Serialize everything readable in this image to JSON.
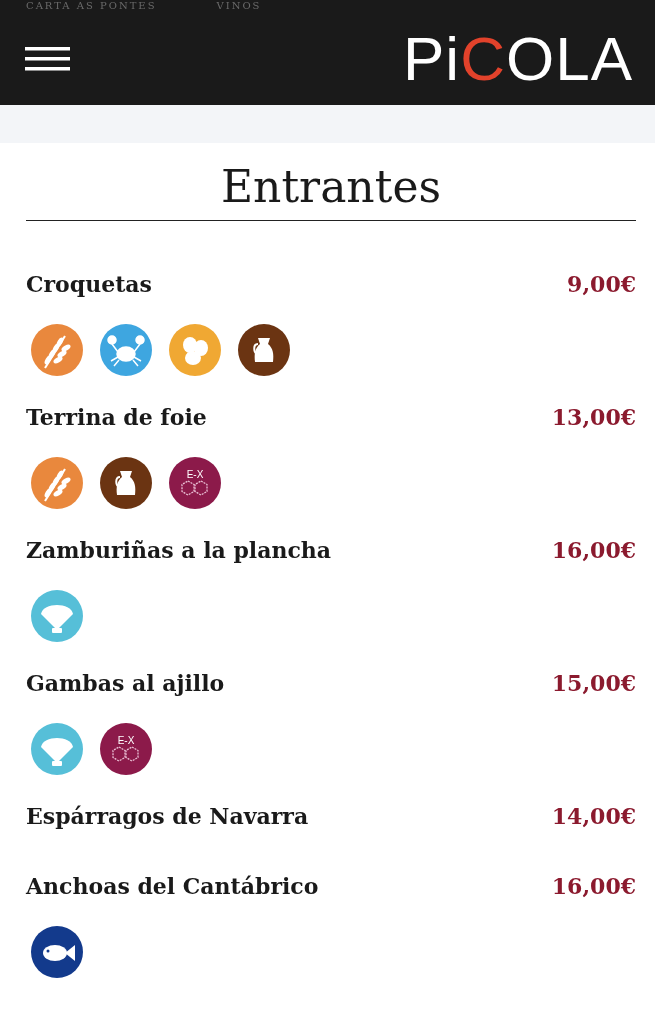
{
  "top_nav": [
    "CARTA AS PONTES",
    "VINOS"
  ],
  "header": {
    "logo": [
      {
        "text": "Pi",
        "accent": false
      },
      {
        "text": "C",
        "accent": true
      },
      {
        "text": "OLA",
        "accent": false
      }
    ]
  },
  "section": {
    "title": "Entrantes",
    "items": [
      {
        "name": "Croquetas",
        "price": "9,00€",
        "allergens": [
          {
            "kind": "gluten"
          },
          {
            "kind": "crustaceans"
          },
          {
            "kind": "eggs"
          },
          {
            "kind": "milk"
          }
        ]
      },
      {
        "name": "Terrina de foie",
        "price": "13,00€",
        "allergens": [
          {
            "kind": "gluten"
          },
          {
            "kind": "milk"
          },
          {
            "kind": "sulphites",
            "label": "E-X"
          }
        ]
      },
      {
        "name": "Zamburiñas a la plancha",
        "price": "16,00€",
        "allergens": [
          {
            "kind": "molluscs"
          }
        ]
      },
      {
        "name": "Gambas al ajillo",
        "price": "15,00€",
        "allergens": [
          {
            "kind": "molluscs"
          },
          {
            "kind": "sulphites",
            "label": "E-X"
          }
        ]
      },
      {
        "name": "Espárragos de Navarra",
        "price": "14,00€"
      },
      {
        "name": "Anchoas del Cantábrico",
        "price": "16,00€",
        "allergens": [
          {
            "kind": "fish"
          }
        ]
      }
    ]
  }
}
